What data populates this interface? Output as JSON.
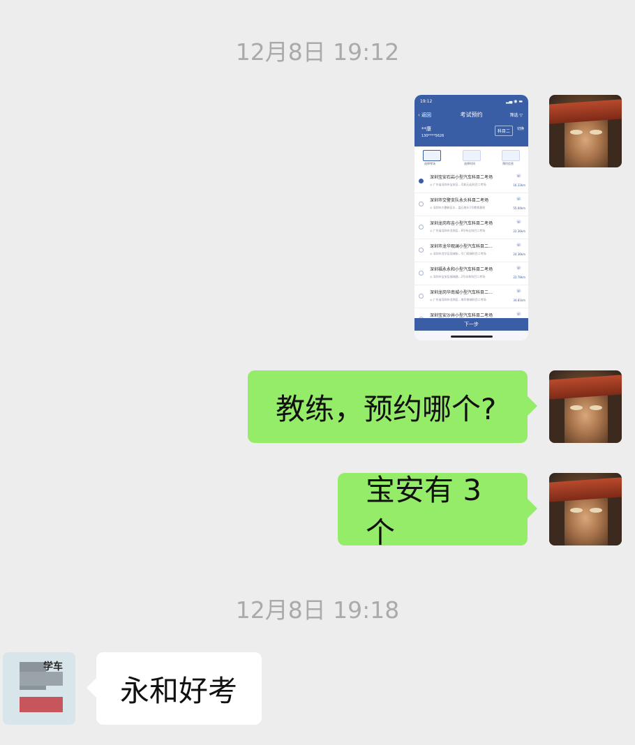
{
  "timestamps": [
    "12月8日 19:12",
    "12月8日 19:18"
  ],
  "messages": {
    "msg1": "教练，预约哪个?",
    "msg2": "宝安有 3 个",
    "msg3": "永和好考"
  },
  "other_avatar_text": "学车",
  "thumbnail": {
    "status_time": "19:12",
    "back": "返回",
    "title": "考试预约",
    "filter": "筛选",
    "user": "**康",
    "phone": "130****5626",
    "subject": "科目二",
    "switch": "切换",
    "steps": [
      "选择考场",
      "选择时间",
      "预约信息"
    ],
    "venues": [
      {
        "name": "深圳宝安石岩小型汽车科目二考场",
        "addr": "广东省深圳市宝安区...司机石岩科目二考场",
        "dist": "16.33km",
        "selected": true
      },
      {
        "name": "深圳市交警支队永头科目二考场",
        "addr": "深圳市大鹏新区水...监石拖头1号教育基地",
        "dist": "55.04km",
        "selected": false
      },
      {
        "name": "深圳龙岗布吉小型汽车科目二考场",
        "addr": "广东省深圳市龙岗区...8号布吉科目二考场",
        "dist": "22.36km",
        "selected": false
      },
      {
        "name": "深圳市龙华观澜小型汽车科目二...",
        "addr": "深圳市龙华区观澜街...号门观澜科目二考场",
        "dist": "24.36km",
        "selected": false
      },
      {
        "name": "深圳福永永和小型汽车科目二考场",
        "addr": "深圳市宝安区福瑞路...2号永和科目二考场",
        "dist": "22.78km",
        "selected": false
      },
      {
        "name": "深圳龙岗华南城小型汽车科目二...",
        "addr": "广东省深圳市龙岗区...南华南城科目二考场",
        "dist": "34.81km",
        "selected": false
      },
      {
        "name": "深圳宝安沙井小型汽车科目二考场",
        "addr": "",
        "dist": "",
        "selected": false
      }
    ],
    "next": "下一步"
  }
}
